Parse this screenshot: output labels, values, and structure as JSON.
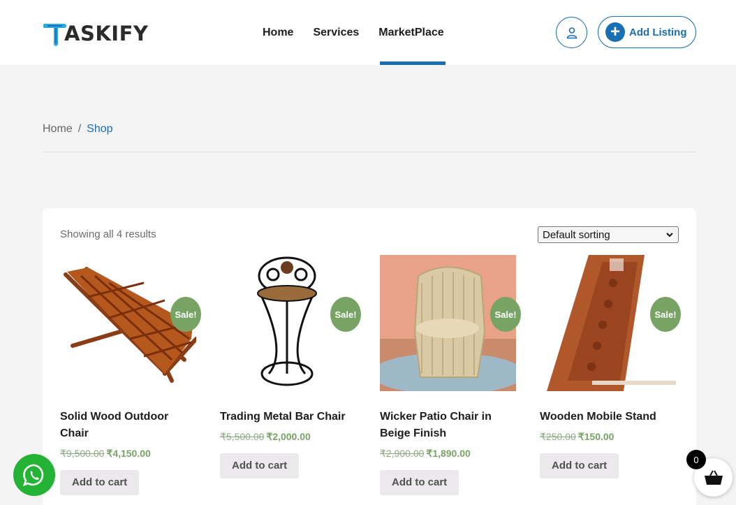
{
  "brand": {
    "name": "ASKIFY",
    "accent": "#1a6fb3",
    "logo_letter_color": "#29abe2"
  },
  "nav": {
    "items": [
      {
        "label": "Home",
        "active": false
      },
      {
        "label": "Services",
        "active": false
      },
      {
        "label": "MarketPlace",
        "active": true
      }
    ]
  },
  "header": {
    "user_icon": "user-icon",
    "add_listing_label": "Add Listing"
  },
  "breadcrumb": {
    "home": "Home",
    "separator": "/",
    "current": "Shop"
  },
  "shop": {
    "result_count": "Showing all 4 results",
    "sorting": {
      "selected": "Default sorting"
    },
    "sale_badge": "Sale!",
    "currency": "₹",
    "products": [
      {
        "title": "Solid Wood Outdoor Chair",
        "old_price": "₹9,500.00",
        "new_price": "₹4,150.00",
        "button": "Add to cart"
      },
      {
        "title": "Trading Metal Bar Chair",
        "old_price": "₹5,500.00",
        "new_price": "₹2,000.00",
        "button": "Add to cart"
      },
      {
        "title": "Wicker Patio Chair in Beige Finish",
        "old_price": "₹2,900.00",
        "new_price": "₹1,890.00",
        "button": "Add to cart"
      },
      {
        "title": "Wooden Mobile Stand",
        "old_price": "₹250.00",
        "new_price": "₹150.00",
        "button": "Add to cart"
      }
    ]
  },
  "floating": {
    "whatsapp_icon": "whatsapp-icon",
    "cart_icon": "basket-icon",
    "cart_count": "0"
  }
}
